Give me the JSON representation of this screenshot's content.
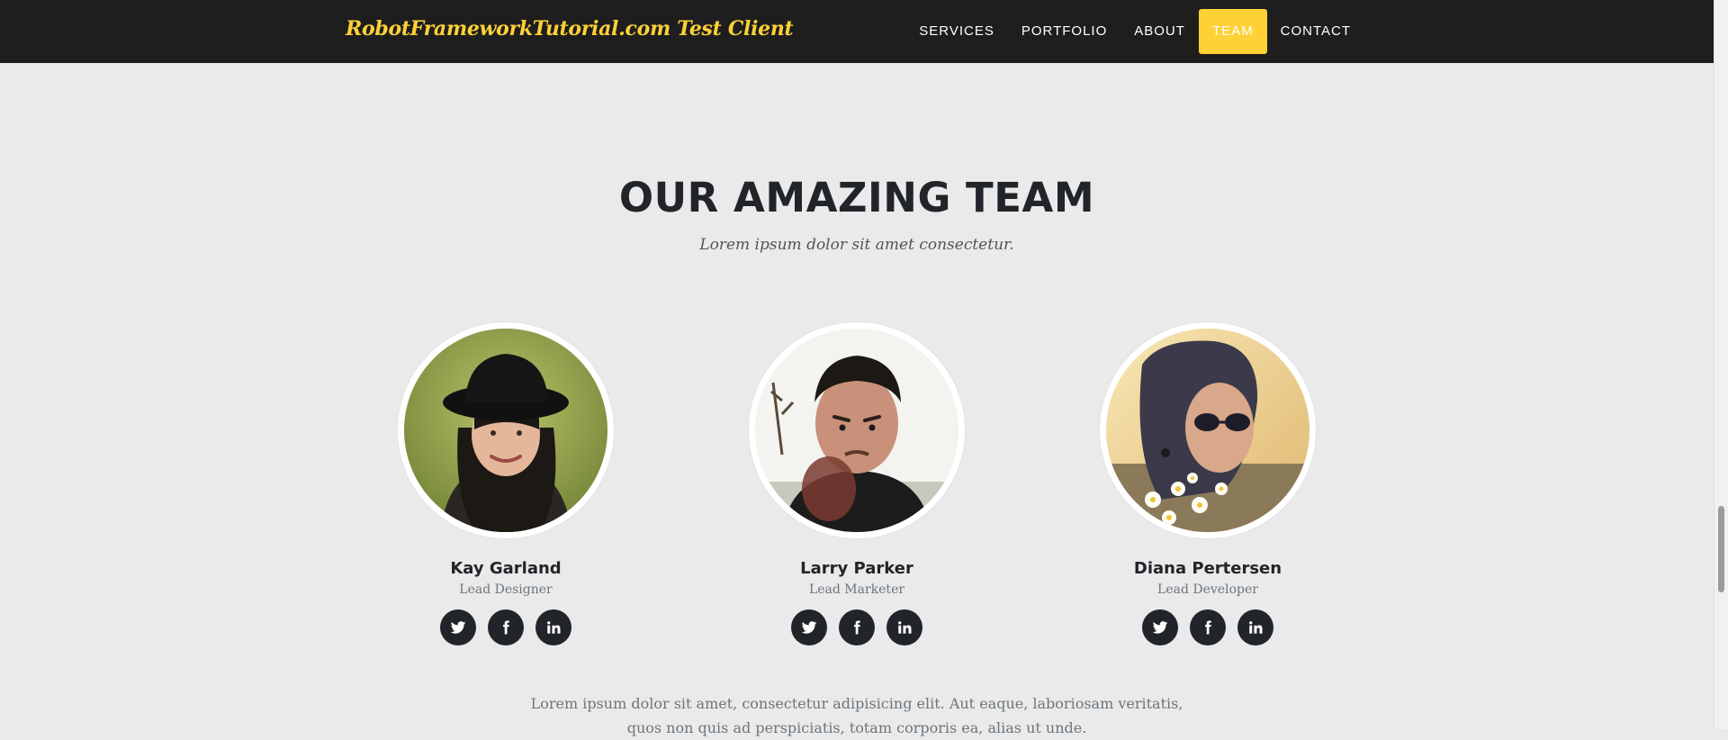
{
  "navbar": {
    "brand": "RobotFrameworkTutorial.com Test Client",
    "items": [
      {
        "label": "SERVICES",
        "active": false
      },
      {
        "label": "PORTFOLIO",
        "active": false
      },
      {
        "label": "ABOUT",
        "active": false
      },
      {
        "label": "TEAM",
        "active": true
      },
      {
        "label": "CONTACT",
        "active": false
      }
    ]
  },
  "team": {
    "title": "OUR AMAZING TEAM",
    "subtitle": "Lorem ipsum dolor sit amet consectetur.",
    "members": [
      {
        "name": "Kay Garland",
        "role": "Lead Designer",
        "socials": [
          "twitter-icon",
          "facebook-icon",
          "linkedin-icon"
        ]
      },
      {
        "name": "Larry Parker",
        "role": "Lead Marketer",
        "socials": [
          "twitter-icon",
          "facebook-icon",
          "linkedin-icon"
        ]
      },
      {
        "name": "Diana Pertersen",
        "role": "Lead Developer",
        "socials": [
          "twitter-icon",
          "facebook-icon",
          "linkedin-icon"
        ]
      }
    ],
    "lead_text": "Lorem ipsum dolor sit amet, consectetur adipisicing elit. Aut eaque, laboriosam veritatis, quos non quis ad perspiciatis, totam corporis ea, alias ut unde."
  },
  "colors": {
    "accent": "#fed136",
    "navbar_bg": "#1e1e1e",
    "page_bg": "#eaeaea",
    "heading": "#212529",
    "muted": "#6c757d"
  }
}
